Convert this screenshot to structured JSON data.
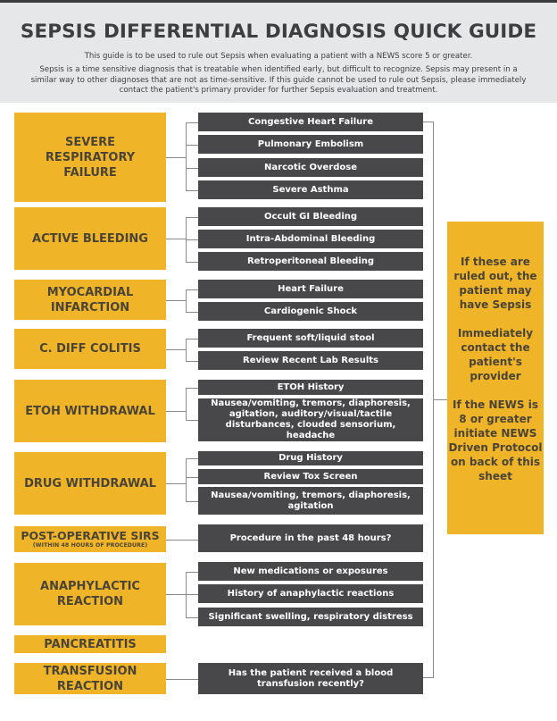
{
  "header": {
    "title": "SEPSIS DIFFERENTIAL DIAGNOSIS QUICK GUIDE",
    "intro": "This guide is to be used to rule out Sepsis when evaluating a patient with a NEWS score 5 or greater.",
    "description": "Sepsis is a time sensitive diagnosis that is treatable when identified early, but difficult to recognize. Sepsis may present in a similar way to other diagnoses that are not as time-sensitive. If this guide cannot be used to rule out Sepsis, please immediately contact the patient's primary provider for further Sepsis evaluation and treatment."
  },
  "colors": {
    "category": "#f0b429",
    "item": "#48484a",
    "header_bg": "#e6e7e9",
    "text_dark": "#3d3e40"
  },
  "categories": [
    {
      "label": "SEVERE RESPIRATORY FAILURE",
      "lines": [
        "SEVERE",
        "RESPIRATORY",
        "FAILURE"
      ],
      "items": [
        "Congestive Heart Failure",
        "Pulmonary Embolism",
        "Narcotic Overdose",
        "Severe Asthma"
      ]
    },
    {
      "label": "ACTIVE BLEEDING",
      "lines": [
        "ACTIVE BLEEDING"
      ],
      "items": [
        "Occult GI Bleeding",
        "Intra-Abdominal Bleeding",
        "Retroperitoneal Bleeding"
      ]
    },
    {
      "label": "MYOCARDIAL INFARCTION",
      "lines": [
        "MYOCARDIAL",
        "INFARCTION"
      ],
      "items": [
        "Heart Failure",
        "Cardiogenic Shock"
      ]
    },
    {
      "label": "C. DIFF COLITIS",
      "lines": [
        "C. DIFF COLITIS"
      ],
      "items": [
        "Frequent soft/liquid stool",
        "Review Recent Lab Results"
      ]
    },
    {
      "label": "ETOH WITHDRAWAL",
      "lines": [
        "ETOH WITHDRAWAL"
      ],
      "items": [
        "ETOH History",
        "Nausea/vomiting, tremors, diaphoresis, agitation, auditory/visual/tactile disturbances, clouded sensorium, headache"
      ]
    },
    {
      "label": "DRUG WITHDRAWAL",
      "lines": [
        "DRUG WITHDRAWAL"
      ],
      "items": [
        "Drug History",
        "Review Tox Screen",
        "Nausea/vomiting, tremors, diaphoresis, agitation"
      ]
    },
    {
      "label": "POST-OPERATIVE SIRS",
      "lines": [
        "POST-OPERATIVE SIRS"
      ],
      "note": "(WITHIN 48 HOURS OF PROCEDURE)",
      "items": [
        "Procedure in the past 48 hours?"
      ]
    },
    {
      "label": "ANAPHYLACTIC REACTION",
      "lines": [
        "ANAPHYLACTIC",
        "REACTION"
      ],
      "items": [
        "New medications or exposures",
        "History of anaphylactic reactions",
        "Significant swelling, respiratory distress"
      ]
    },
    {
      "label": "PANCREATITIS",
      "lines": [
        "PANCREATITIS"
      ],
      "items": []
    },
    {
      "label": "TRANSFUSION REACTION",
      "lines": [
        "TRANSFUSION",
        "REACTION"
      ],
      "items": [
        "Has the patient received a blood transfusion recently?"
      ]
    }
  ],
  "sidebar": {
    "paragraphs": [
      "If these are ruled out, the patient may have Sepsis",
      "Immediately contact the patient's provider",
      "If the NEWS is 8 or greater initiate NEWS Driven Protocol on back of this sheet"
    ]
  }
}
